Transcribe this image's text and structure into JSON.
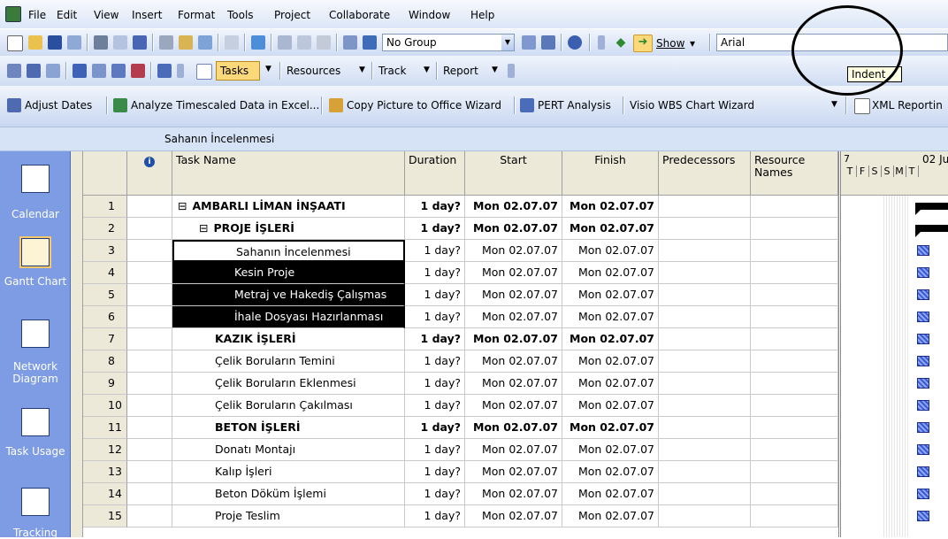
{
  "menu": {
    "items": [
      "File",
      "Edit",
      "View",
      "Insert",
      "Format",
      "Tools",
      "Project",
      "Collaborate",
      "Window",
      "Help"
    ]
  },
  "toolbar1": {
    "group_value": "No Group",
    "show_label": "Show",
    "font_value": "Arial",
    "tooltip": "Indent"
  },
  "toolbar2": {
    "tasks_label": "Tasks",
    "resources_label": "Resources",
    "track_label": "Track",
    "report_label": "Report"
  },
  "toolbar3": {
    "adjust_dates": "Adjust Dates",
    "analyze": "Analyze Timescaled Data in Excel...",
    "copy_picture": "Copy Picture to Office Wizard",
    "pert": "PERT Analysis",
    "visio": "Visio WBS Chart Wizard",
    "xml": "XML Reportin"
  },
  "editbar": {
    "value": "Sahanın İncelenmesi"
  },
  "viewbar": {
    "calendar": "Calendar",
    "gantt": "Gantt Chart",
    "network": "Network Diagram",
    "task_usage": "Task Usage",
    "tracking": "Tracking"
  },
  "table": {
    "headers": {
      "task_name": "Task Name",
      "duration": "Duration",
      "start": "Start",
      "finish": "Finish",
      "predecessors": "Predecessors",
      "resource_names": "Resource Names",
      "info_icon": "i"
    },
    "rows": [
      {
        "id": "1",
        "name": "AMBARLI LİMAN İNŞAATI",
        "duration": "1 day?",
        "start": "Mon 02.07.07",
        "finish": "Mon 02.07.07"
      },
      {
        "id": "2",
        "name": "PROJE İŞLERİ",
        "duration": "1 day?",
        "start": "Mon 02.07.07",
        "finish": "Mon 02.07.07"
      },
      {
        "id": "3",
        "name": "Sahanın İncelenmesi",
        "duration": "1 day?",
        "start": "Mon 02.07.07",
        "finish": "Mon 02.07.07"
      },
      {
        "id": "4",
        "name": "Kesin Proje",
        "duration": "1 day?",
        "start": "Mon 02.07.07",
        "finish": "Mon 02.07.07"
      },
      {
        "id": "5",
        "name": "Metraj ve Hakediş Çalışmas",
        "duration": "1 day?",
        "start": "Mon 02.07.07",
        "finish": "Mon 02.07.07"
      },
      {
        "id": "6",
        "name": "İhale Dosyası Hazırlanması",
        "duration": "1 day?",
        "start": "Mon 02.07.07",
        "finish": "Mon 02.07.07"
      },
      {
        "id": "7",
        "name": "KAZIK İŞLERİ",
        "duration": "1 day?",
        "start": "Mon 02.07.07",
        "finish": "Mon 02.07.07"
      },
      {
        "id": "8",
        "name": "Çelik Boruların Temini",
        "duration": "1 day?",
        "start": "Mon 02.07.07",
        "finish": "Mon 02.07.07"
      },
      {
        "id": "9",
        "name": "Çelik Boruların Eklenmesi",
        "duration": "1 day?",
        "start": "Mon 02.07.07",
        "finish": "Mon 02.07.07"
      },
      {
        "id": "10",
        "name": "Çelik Boruların Çakılması",
        "duration": "1 day?",
        "start": "Mon 02.07.07",
        "finish": "Mon 02.07.07"
      },
      {
        "id": "11",
        "name": "BETON İŞLERİ",
        "duration": "1 day?",
        "start": "Mon 02.07.07",
        "finish": "Mon 02.07.07"
      },
      {
        "id": "12",
        "name": "Donatı Montajı",
        "duration": "1 day?",
        "start": "Mon 02.07.07",
        "finish": "Mon 02.07.07"
      },
      {
        "id": "13",
        "name": "Kalıp İşleri",
        "duration": "1 day?",
        "start": "Mon 02.07.07",
        "finish": "Mon 02.07.07"
      },
      {
        "id": "14",
        "name": "Beton Döküm İşlemi",
        "duration": "1 day?",
        "start": "Mon 02.07.07",
        "finish": "Mon 02.07.07"
      },
      {
        "id": "15",
        "name": "Proje Teslim",
        "duration": "1 day?",
        "start": "Mon 02.07.07",
        "finish": "Mon 02.07.07"
      }
    ]
  },
  "gantt": {
    "week_label": "02 Ju",
    "prev_marker": "7",
    "days": [
      "T",
      "F",
      "S",
      "S",
      "M",
      "T"
    ]
  }
}
